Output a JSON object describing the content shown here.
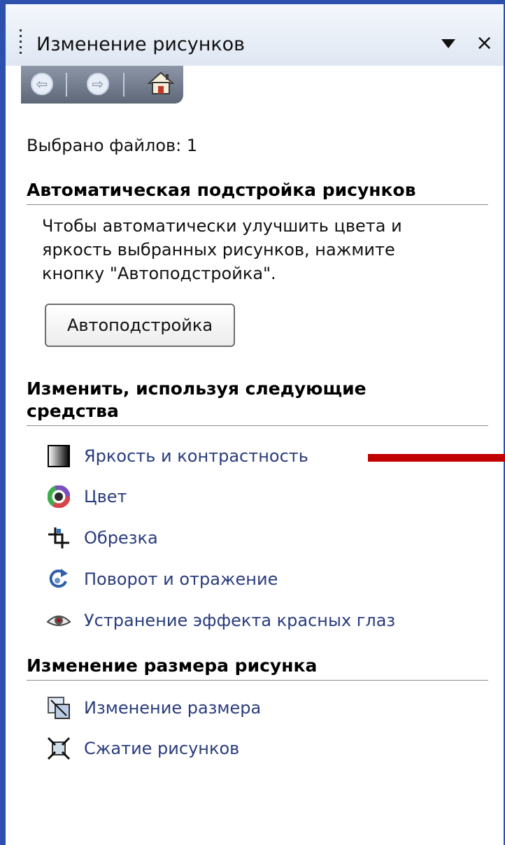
{
  "panel": {
    "title": "Изменение рисунков",
    "nav": {
      "back_icon": "back-arrow-icon",
      "forward_icon": "forward-arrow-icon",
      "home_icon": "home-icon"
    }
  },
  "selected_files": "Выбрано файлов: 1",
  "auto_section": {
    "heading": "Автоматическая подстройка рисунков",
    "lines": [
      "Чтобы автоматически улучшить цвета и",
      "яркость выбранных рисунков, нажмите",
      "кнопку \"Автоподстройка\"."
    ],
    "button_label": "Автоподстройка"
  },
  "tools_section": {
    "heading_line1": "Изменить, используя следующие",
    "heading_line2": "средства",
    "items": [
      {
        "label": "Яркость и контрастность",
        "icon": "brightness-contrast-icon"
      },
      {
        "label": "Цвет",
        "icon": "color-wheel-icon"
      },
      {
        "label": "Обрезка",
        "icon": "crop-icon"
      },
      {
        "label": "Поворот и отражение",
        "icon": "rotate-flip-icon"
      },
      {
        "label": "Устранение эффекта красных глаз",
        "icon": "red-eye-icon"
      }
    ]
  },
  "size_section": {
    "heading": "Изменение размера рисунка",
    "items": [
      {
        "label": "Изменение размера",
        "icon": "resize-icon"
      },
      {
        "label": "Сжатие рисунков",
        "icon": "compress-icon"
      }
    ]
  },
  "colors": {
    "frame_border": "#2d4fae",
    "link_text": "#2a3c7c",
    "annotation_arrow": "#c00000"
  }
}
